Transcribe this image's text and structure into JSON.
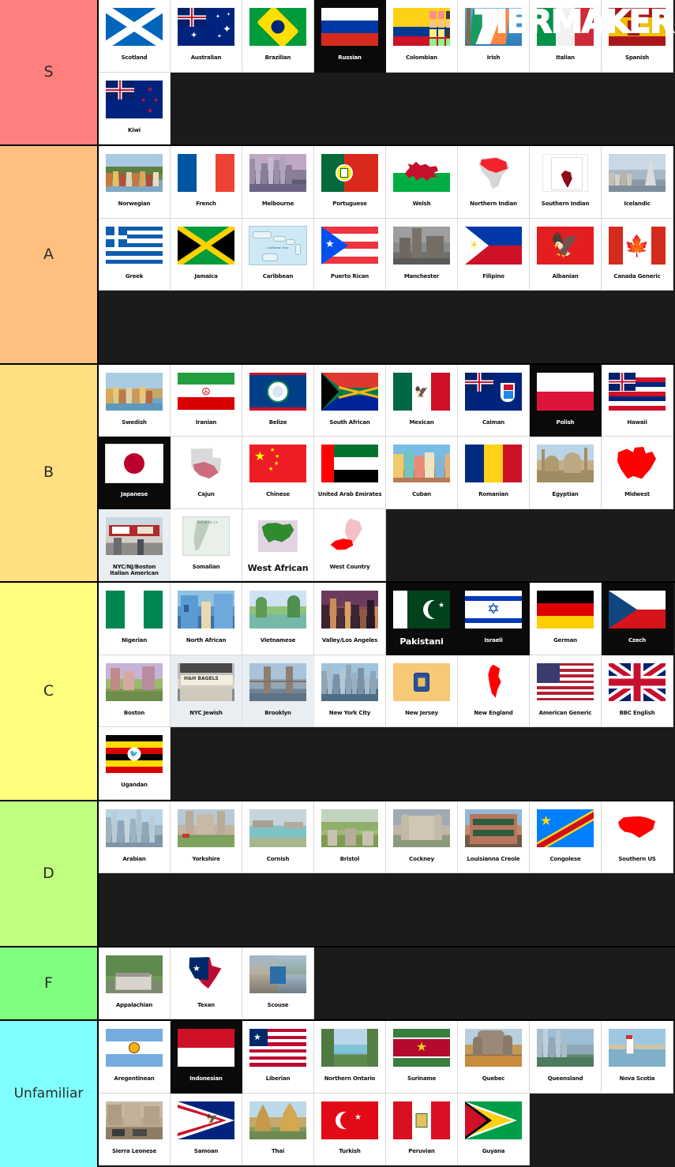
{
  "watermark": "TIERMAKER",
  "theme": {
    "background": "#1b1b1b",
    "cell_background": "#ffffff",
    "border": "#000000",
    "label_text": "#2b2b2b"
  },
  "tiers": [
    {
      "label": "S",
      "color": "#FF7F7F",
      "items": [
        {
          "name": "Scotland",
          "art": "flag-scotland",
          "dark": false
        },
        {
          "name": "Australian",
          "art": "flag-australia",
          "dark": false
        },
        {
          "name": "Brazilian",
          "art": "flag-brazil",
          "dark": false
        },
        {
          "name": "Russian",
          "art": "flag-russia",
          "dark": true
        },
        {
          "name": "Colombian",
          "art": "flag-colombia",
          "dark": false
        },
        {
          "name": "Irish",
          "art": "flag-ireland",
          "dark": false
        },
        {
          "name": "Italian",
          "art": "flag-italy",
          "dark": false
        },
        {
          "name": "Spanish",
          "art": "flag-spain",
          "dark": false
        },
        {
          "name": "Kiwi",
          "art": "flag-newzealand",
          "dark": false
        }
      ]
    },
    {
      "label": "A",
      "color": "#FFBF7F",
      "items": [
        {
          "name": "Norwegian",
          "art": "photo-bergen",
          "dark": false
        },
        {
          "name": "French",
          "art": "flag-france",
          "dark": false
        },
        {
          "name": "Melbourne",
          "art": "photo-melbourne",
          "dark": false
        },
        {
          "name": "Portuguese",
          "art": "flag-portugal",
          "dark": false
        },
        {
          "name": "Welsh",
          "art": "flag-wales",
          "dark": false
        },
        {
          "name": "Northern Indian",
          "art": "map-north-india",
          "dark": false
        },
        {
          "name": "Southern Indian",
          "art": "map-south-india",
          "dark": false
        },
        {
          "name": "Icelandic",
          "art": "photo-reykjavik",
          "dark": false
        },
        {
          "name": "Greek",
          "art": "flag-greece",
          "dark": false
        },
        {
          "name": "Jamaica",
          "art": "flag-jamaica",
          "dark": false
        },
        {
          "name": "Caribbean",
          "art": "map-caribbean",
          "dark": false
        },
        {
          "name": "Puerto Rican",
          "art": "flag-puertorico",
          "dark": false
        },
        {
          "name": "Manchester",
          "art": "photo-manchester",
          "dark": false
        },
        {
          "name": "Filipino",
          "art": "flag-philippines",
          "dark": false
        },
        {
          "name": "Albanian",
          "art": "flag-albania",
          "dark": false
        },
        {
          "name": "Canada Generic",
          "art": "flag-canada",
          "dark": false
        }
      ]
    },
    {
      "label": "B",
      "color": "#FFDF7F",
      "items": [
        {
          "name": "Swedish",
          "art": "photo-stockholm",
          "dark": false
        },
        {
          "name": "Iranian",
          "art": "flag-iran",
          "dark": false
        },
        {
          "name": "Belize",
          "art": "flag-belize",
          "dark": false
        },
        {
          "name": "South African",
          "art": "flag-southafrica",
          "dark": false
        },
        {
          "name": "Mexican",
          "art": "flag-mexico",
          "dark": false
        },
        {
          "name": "Caiman",
          "art": "flag-cayman",
          "dark": false
        },
        {
          "name": "Polish",
          "art": "flag-poland",
          "dark": true
        },
        {
          "name": "Hawaii",
          "art": "flag-hawaii",
          "dark": false
        },
        {
          "name": "Japanese",
          "art": "flag-japan",
          "dark": true
        },
        {
          "name": "Cajun",
          "art": "map-louisiana",
          "dark": false
        },
        {
          "name": "Chinese",
          "art": "flag-china",
          "dark": false
        },
        {
          "name": "United Arab Emirates",
          "art": "flag-uae",
          "dark": false
        },
        {
          "name": "Cuban",
          "art": "photo-havana",
          "dark": false
        },
        {
          "name": "Romanian",
          "art": "flag-romania",
          "dark": false
        },
        {
          "name": "Egyptian",
          "art": "photo-cairo",
          "dark": false
        },
        {
          "name": "Midwest",
          "art": "map-midwest",
          "dark": false
        },
        {
          "name": "NYC/NJ/Boston\nItalian American",
          "art": "photo-deli",
          "dark": false,
          "grey": true
        },
        {
          "name": "Somalian",
          "art": "map-somalia",
          "dark": false
        },
        {
          "name": "West African",
          "art": "map-westafrica",
          "dark": false,
          "big_caption": true
        },
        {
          "name": "West Country",
          "art": "map-westcountry",
          "dark": false
        }
      ]
    },
    {
      "label": "C",
      "color": "#FFFF7F",
      "items": [
        {
          "name": "Nigerian",
          "art": "flag-nigeria",
          "dark": false
        },
        {
          "name": "North African",
          "art": "photo-chefchaouen",
          "dark": false
        },
        {
          "name": "Vietnamese",
          "art": "photo-vietnam",
          "dark": false
        },
        {
          "name": "Valley/Los Angeles",
          "art": "photo-la",
          "dark": false
        },
        {
          "name": "Pakistani",
          "art": "flag-pakistan",
          "dark": true,
          "big_caption": true
        },
        {
          "name": "Israeli",
          "art": "flag-israel",
          "dark": true
        },
        {
          "name": "German",
          "art": "flag-germany",
          "dark": false
        },
        {
          "name": "Czech",
          "art": "flag-czech",
          "dark": true
        },
        {
          "name": "Boston",
          "art": "photo-boston",
          "dark": false
        },
        {
          "name": "NYC Jewish",
          "art": "photo-bagels",
          "dark": false,
          "grey": true
        },
        {
          "name": "Brooklyn",
          "art": "photo-brooklyn",
          "dark": false,
          "grey": true
        },
        {
          "name": "New York City",
          "art": "photo-nyc",
          "dark": false
        },
        {
          "name": "New Jersey",
          "art": "flag-newjersey",
          "dark": false
        },
        {
          "name": "New England",
          "art": "map-newengland",
          "dark": false
        },
        {
          "name": "American Generic",
          "art": "flag-usa",
          "dark": false
        },
        {
          "name": "BBC English",
          "art": "flag-uk",
          "dark": false
        },
        {
          "name": "Ugandan",
          "art": "flag-uganda",
          "dark": false
        }
      ]
    },
    {
      "label": "D",
      "color": "#BFFF7F",
      "items": [
        {
          "name": "Arabian",
          "art": "photo-dubai",
          "dark": false
        },
        {
          "name": "Yorkshire",
          "art": "photo-york",
          "dark": false
        },
        {
          "name": "Cornish",
          "art": "photo-cornwall",
          "dark": false
        },
        {
          "name": "Bristol",
          "art": "photo-bristol",
          "dark": false
        },
        {
          "name": "Cockney",
          "art": "photo-toweroflondon",
          "dark": false
        },
        {
          "name": "Louisianna Creole",
          "art": "photo-neworleans",
          "dark": false
        },
        {
          "name": "Congolese",
          "art": "flag-drcongo",
          "dark": false
        },
        {
          "name": "Southern US",
          "art": "map-southernus",
          "dark": false
        }
      ]
    },
    {
      "label": "F",
      "color": "#7FFF7F",
      "items": [
        {
          "name": "Appalachian",
          "art": "photo-appalachia",
          "dark": false
        },
        {
          "name": "Texan",
          "art": "map-texas",
          "dark": false
        },
        {
          "name": "Scouse",
          "art": "photo-liverpool",
          "dark": false
        }
      ]
    },
    {
      "label": "Unfamiliar",
      "color": "#7FFFFF",
      "items": [
        {
          "name": "Aregentinean",
          "art": "flag-argentina",
          "dark": false
        },
        {
          "name": "Indonesian",
          "art": "flag-indonesia",
          "dark": true
        },
        {
          "name": "Liberian",
          "art": "flag-liberia",
          "dark": false
        },
        {
          "name": "Northern Ontario",
          "art": "photo-ontario",
          "dark": false
        },
        {
          "name": "Suriname",
          "art": "flag-suriname",
          "dark": false
        },
        {
          "name": "Quebec",
          "art": "photo-quebec",
          "dark": false
        },
        {
          "name": "Queensland",
          "art": "photo-queensland",
          "dark": false
        },
        {
          "name": "Nova Scotia",
          "art": "photo-novascotia",
          "dark": false
        },
        {
          "name": "Sierra Leonese",
          "art": "photo-freetown",
          "dark": false
        },
        {
          "name": "Samoan",
          "art": "flag-americansamoa",
          "dark": false
        },
        {
          "name": "Thai",
          "art": "photo-thailand",
          "dark": false
        },
        {
          "name": "Turkish",
          "art": "flag-turkey",
          "dark": false
        },
        {
          "name": "Peruvian",
          "art": "flag-peru",
          "dark": false
        },
        {
          "name": "Guyana",
          "art": "flag-guyana",
          "dark": false
        }
      ]
    }
  ]
}
